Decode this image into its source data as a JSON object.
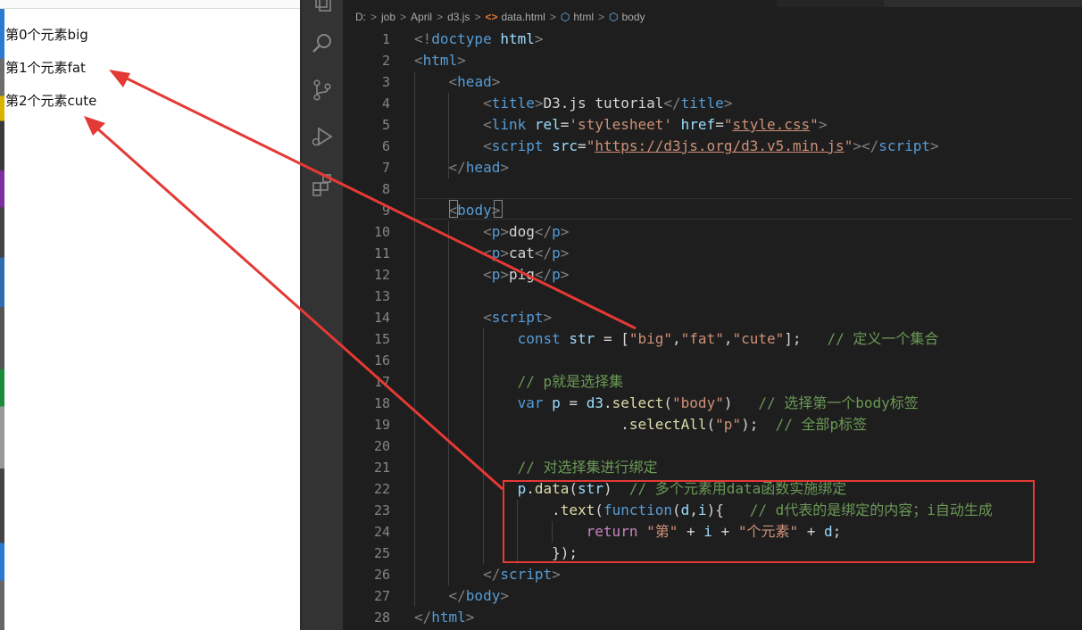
{
  "browser": {
    "outputs": [
      "第0个元素big",
      "第1个元素fat",
      "第2个元素cute"
    ]
  },
  "breadcrumb": {
    "items": [
      "D:",
      "job",
      "April",
      "d3.js",
      "data.html",
      "html",
      "body"
    ],
    "separator": ">"
  },
  "activity_bar": {
    "icons": [
      "explorer-icon",
      "search-icon",
      "source-control-icon",
      "run-debug-icon",
      "extensions-icon"
    ]
  },
  "editor": {
    "lines": [
      {
        "n": "1",
        "tokens": [
          {
            "t": "<!",
            "c": "br"
          },
          {
            "t": "doctype",
            "c": "tag"
          },
          {
            "t": " ",
            "c": ""
          },
          {
            "t": "html",
            "c": "attr"
          },
          {
            "t": ">",
            "c": "br"
          }
        ]
      },
      {
        "n": "2",
        "tokens": [
          {
            "t": "<",
            "c": "br"
          },
          {
            "t": "html",
            "c": "tag"
          },
          {
            "t": ">",
            "c": "br"
          }
        ]
      },
      {
        "n": "3",
        "tokens": [
          {
            "t": "    ",
            "c": ""
          },
          {
            "t": "<",
            "c": "br"
          },
          {
            "t": "head",
            "c": "tag"
          },
          {
            "t": ">",
            "c": "br"
          }
        ]
      },
      {
        "n": "4",
        "tokens": [
          {
            "t": "        ",
            "c": ""
          },
          {
            "t": "<",
            "c": "br"
          },
          {
            "t": "title",
            "c": "tag"
          },
          {
            "t": ">",
            "c": "br"
          },
          {
            "t": "D3.js tutorial",
            "c": ""
          },
          {
            "t": "</",
            "c": "br"
          },
          {
            "t": "title",
            "c": "tag"
          },
          {
            "t": ">",
            "c": "br"
          }
        ]
      },
      {
        "n": "5",
        "tokens": [
          {
            "t": "        ",
            "c": ""
          },
          {
            "t": "<",
            "c": "br"
          },
          {
            "t": "link",
            "c": "tag"
          },
          {
            "t": " ",
            "c": ""
          },
          {
            "t": "rel",
            "c": "attr"
          },
          {
            "t": "=",
            "c": ""
          },
          {
            "t": "'stylesheet'",
            "c": "str"
          },
          {
            "t": " ",
            "c": ""
          },
          {
            "t": "href",
            "c": "attr"
          },
          {
            "t": "=",
            "c": ""
          },
          {
            "t": "\"",
            "c": "str"
          },
          {
            "t": "style.css",
            "c": "url"
          },
          {
            "t": "\"",
            "c": "str"
          },
          {
            "t": ">",
            "c": "br"
          }
        ]
      },
      {
        "n": "6",
        "tokens": [
          {
            "t": "        ",
            "c": ""
          },
          {
            "t": "<",
            "c": "br"
          },
          {
            "t": "script",
            "c": "tag"
          },
          {
            "t": " ",
            "c": ""
          },
          {
            "t": "src",
            "c": "attr"
          },
          {
            "t": "=",
            "c": ""
          },
          {
            "t": "\"",
            "c": "str"
          },
          {
            "t": "https://d3js.org/d3.v5.min.js",
            "c": "url"
          },
          {
            "t": "\"",
            "c": "str"
          },
          {
            "t": "></",
            "c": "br"
          },
          {
            "t": "script",
            "c": "tag"
          },
          {
            "t": ">",
            "c": "br"
          }
        ]
      },
      {
        "n": "7",
        "tokens": [
          {
            "t": "    ",
            "c": ""
          },
          {
            "t": "</",
            "c": "br"
          },
          {
            "t": "head",
            "c": "tag"
          },
          {
            "t": ">",
            "c": "br"
          }
        ]
      },
      {
        "n": "8",
        "tokens": []
      },
      {
        "n": "9",
        "tokens": [
          {
            "t": "    ",
            "c": ""
          },
          {
            "t": "<",
            "c": "br"
          },
          {
            "t": "body",
            "c": "tag"
          },
          {
            "t": ">",
            "c": "br"
          }
        ]
      },
      {
        "n": "10",
        "tokens": [
          {
            "t": "        ",
            "c": ""
          },
          {
            "t": "<",
            "c": "br"
          },
          {
            "t": "p",
            "c": "tag"
          },
          {
            "t": ">",
            "c": "br"
          },
          {
            "t": "dog",
            "c": ""
          },
          {
            "t": "</",
            "c": "br"
          },
          {
            "t": "p",
            "c": "tag"
          },
          {
            "t": ">",
            "c": "br"
          }
        ]
      },
      {
        "n": "11",
        "tokens": [
          {
            "t": "        ",
            "c": ""
          },
          {
            "t": "<",
            "c": "br"
          },
          {
            "t": "p",
            "c": "tag"
          },
          {
            "t": ">",
            "c": "br"
          },
          {
            "t": "cat",
            "c": ""
          },
          {
            "t": "</",
            "c": "br"
          },
          {
            "t": "p",
            "c": "tag"
          },
          {
            "t": ">",
            "c": "br"
          }
        ]
      },
      {
        "n": "12",
        "tokens": [
          {
            "t": "        ",
            "c": ""
          },
          {
            "t": "<",
            "c": "br"
          },
          {
            "t": "p",
            "c": "tag"
          },
          {
            "t": ">",
            "c": "br"
          },
          {
            "t": "pig",
            "c": ""
          },
          {
            "t": "</",
            "c": "br"
          },
          {
            "t": "p",
            "c": "tag"
          },
          {
            "t": ">",
            "c": "br"
          }
        ]
      },
      {
        "n": "13",
        "tokens": []
      },
      {
        "n": "14",
        "tokens": [
          {
            "t": "        ",
            "c": ""
          },
          {
            "t": "<",
            "c": "br"
          },
          {
            "t": "script",
            "c": "tag"
          },
          {
            "t": ">",
            "c": "br"
          }
        ]
      },
      {
        "n": "15",
        "tokens": [
          {
            "t": "            ",
            "c": ""
          },
          {
            "t": "const",
            "c": "kw"
          },
          {
            "t": " ",
            "c": ""
          },
          {
            "t": "str",
            "c": "var"
          },
          {
            "t": " = [",
            "c": ""
          },
          {
            "t": "\"big\"",
            "c": "str"
          },
          {
            "t": ",",
            "c": ""
          },
          {
            "t": "\"fat\"",
            "c": "str"
          },
          {
            "t": ",",
            "c": ""
          },
          {
            "t": "\"cute\"",
            "c": "str"
          },
          {
            "t": "];   ",
            "c": ""
          },
          {
            "t": "// 定义一个集合",
            "c": "cmt"
          }
        ]
      },
      {
        "n": "16",
        "tokens": []
      },
      {
        "n": "17",
        "tokens": [
          {
            "t": "            ",
            "c": ""
          },
          {
            "t": "// p就是选择集",
            "c": "cmt"
          }
        ]
      },
      {
        "n": "18",
        "tokens": [
          {
            "t": "            ",
            "c": ""
          },
          {
            "t": "var",
            "c": "kw"
          },
          {
            "t": " ",
            "c": ""
          },
          {
            "t": "p",
            "c": "var"
          },
          {
            "t": " = ",
            "c": ""
          },
          {
            "t": "d3",
            "c": "var"
          },
          {
            "t": ".",
            "c": ""
          },
          {
            "t": "select",
            "c": "fn"
          },
          {
            "t": "(",
            "c": ""
          },
          {
            "t": "\"body\"",
            "c": "str"
          },
          {
            "t": ")   ",
            "c": ""
          },
          {
            "t": "// 选择第一个body标签",
            "c": "cmt"
          }
        ]
      },
      {
        "n": "19",
        "tokens": [
          {
            "t": "                        .",
            "c": ""
          },
          {
            "t": "selectAll",
            "c": "fn"
          },
          {
            "t": "(",
            "c": ""
          },
          {
            "t": "\"p\"",
            "c": "str"
          },
          {
            "t": ");  ",
            "c": ""
          },
          {
            "t": "// 全部p标签",
            "c": "cmt"
          }
        ]
      },
      {
        "n": "20",
        "tokens": []
      },
      {
        "n": "21",
        "tokens": [
          {
            "t": "            ",
            "c": ""
          },
          {
            "t": "// 对选择集进行绑定",
            "c": "cmt"
          }
        ]
      },
      {
        "n": "22",
        "tokens": [
          {
            "t": "            ",
            "c": ""
          },
          {
            "t": "p",
            "c": "var"
          },
          {
            "t": ".",
            "c": ""
          },
          {
            "t": "data",
            "c": "fn"
          },
          {
            "t": "(",
            "c": ""
          },
          {
            "t": "str",
            "c": "var"
          },
          {
            "t": ")  ",
            "c": ""
          },
          {
            "t": "// 多个元素用data函数实施绑定",
            "c": "cmt"
          }
        ]
      },
      {
        "n": "23",
        "tokens": [
          {
            "t": "                .",
            "c": ""
          },
          {
            "t": "text",
            "c": "fn"
          },
          {
            "t": "(",
            "c": ""
          },
          {
            "t": "function",
            "c": "kw"
          },
          {
            "t": "(",
            "c": ""
          },
          {
            "t": "d",
            "c": "var"
          },
          {
            "t": ",",
            "c": ""
          },
          {
            "t": "i",
            "c": "var"
          },
          {
            "t": "){   ",
            "c": ""
          },
          {
            "t": "// d代表的是绑定的内容；i自动生成",
            "c": "cmt"
          }
        ]
      },
      {
        "n": "24",
        "tokens": [
          {
            "t": "                    ",
            "c": ""
          },
          {
            "t": "return",
            "c": "ctrl"
          },
          {
            "t": " ",
            "c": ""
          },
          {
            "t": "\"第\"",
            "c": "str"
          },
          {
            "t": " + ",
            "c": ""
          },
          {
            "t": "i",
            "c": "var"
          },
          {
            "t": " + ",
            "c": ""
          },
          {
            "t": "\"个元素\"",
            "c": "str"
          },
          {
            "t": " + ",
            "c": ""
          },
          {
            "t": "d",
            "c": "var"
          },
          {
            "t": ";",
            "c": ""
          }
        ]
      },
      {
        "n": "25",
        "tokens": [
          {
            "t": "                });",
            "c": ""
          }
        ]
      },
      {
        "n": "26",
        "tokens": [
          {
            "t": "        ",
            "c": ""
          },
          {
            "t": "</",
            "c": "br"
          },
          {
            "t": "script",
            "c": "tag"
          },
          {
            "t": ">",
            "c": "br"
          }
        ]
      },
      {
        "n": "27",
        "tokens": [
          {
            "t": "    ",
            "c": ""
          },
          {
            "t": "</",
            "c": "br"
          },
          {
            "t": "body",
            "c": "tag"
          },
          {
            "t": ">",
            "c": "br"
          }
        ]
      },
      {
        "n": "28",
        "tokens": [
          {
            "t": "</",
            "c": "br"
          },
          {
            "t": "html",
            "c": "tag"
          },
          {
            "t": ">",
            "c": "br"
          }
        ]
      }
    ]
  },
  "colors": {
    "annotation_red": "#e53935",
    "editor_bg": "#1e1e1e",
    "activity_bar_bg": "#333333"
  }
}
